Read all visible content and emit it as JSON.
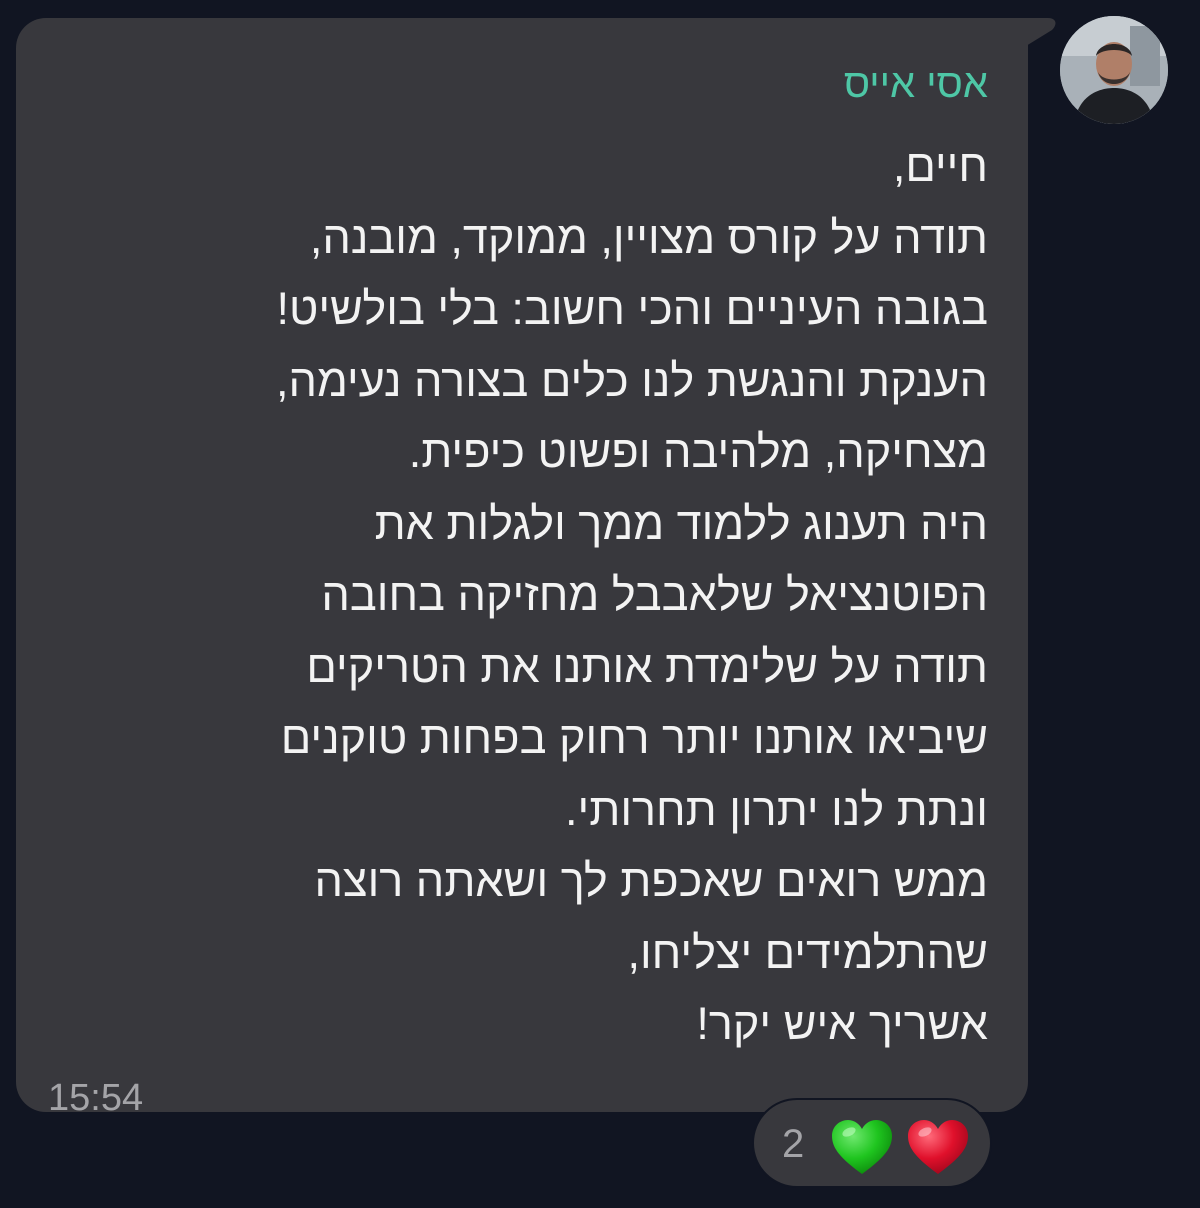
{
  "message": {
    "sender_name": "אסי אייס",
    "lines": [
      "חיים,",
      "תודה על קורס מצויין, ממוקד, מובנה,",
      "בגובה העיניים והכי חשוב: בלי בולשיט!",
      "הענקת והנגשת לנו כלים בצורה נעימה,",
      "מצחיקה, מלהיבה ופשוט כיפית.",
      "היה תענוג ללמוד ממך ולגלות את",
      "הפוטנציאל שלאבבל מחזיקה בחובה",
      "תודה על שלימדת אותנו את הטריקים",
      "שיביאו אותנו יותר רחוק בפחות טוקנים",
      "ונתת לנו יתרון תחרותי.",
      "ממש רואים שאכפת לך ושאתה רוצה",
      "שהתלמידים יצליחו,",
      "אשריך איש יקר!"
    ],
    "time": "15:54"
  },
  "reactions": {
    "count": "2",
    "emojis": [
      "green-heart",
      "red-heart"
    ]
  },
  "colors": {
    "background": "#111522",
    "bubble": "#38383d",
    "sender_name": "#4ec7a6",
    "text": "#f3f3f3",
    "meta_text": "#a4a4a8",
    "green_heart": "#1fc51f",
    "red_heart": "#e0102b"
  }
}
